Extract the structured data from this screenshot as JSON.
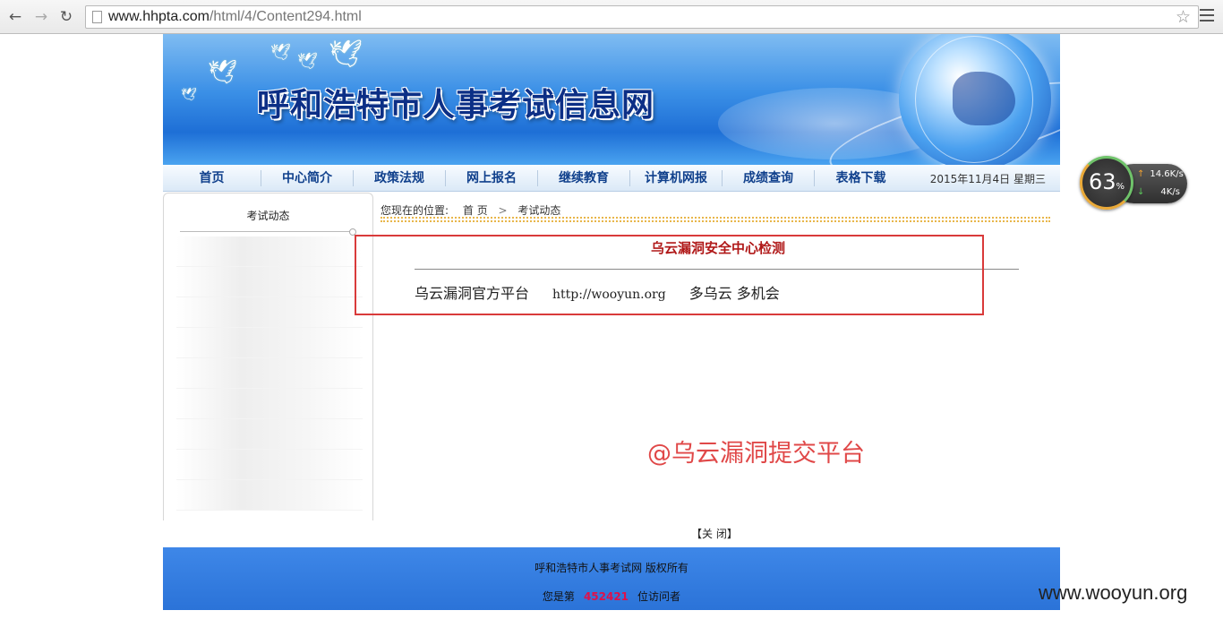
{
  "browser": {
    "url_host": "www.hhpta.com",
    "url_path": "/html/4/Content294.html"
  },
  "site": {
    "title": "呼和浩特市人事考试信息网",
    "nav": [
      "首页",
      "中心简介",
      "政策法规",
      "网上报名",
      "继续教育",
      "计算机网报",
      "成绩查询",
      "表格下载"
    ],
    "date": "2015年11月4日  星期三"
  },
  "sidebar": {
    "title": "考试动态"
  },
  "breadcrumb": {
    "prefix": "您现在的位置:",
    "home": "首 页",
    "separator": ">",
    "current": "考试动态"
  },
  "article": {
    "title": "乌云漏洞安全中心检测",
    "body_left": "乌云漏洞官方平台",
    "body_url": "http://wooyun.org",
    "body_right": "多乌云  多机会"
  },
  "watermark_cn": "@乌云漏洞提交平台",
  "close_link": "【关 闭】",
  "footer": {
    "copyright": "呼和浩特市人事考试网  版权所有",
    "visitor_prefix": "您是第",
    "visitor_count": "452421",
    "visitor_suffix": "位访问者"
  },
  "speed_widget": {
    "percent": "63",
    "percent_unit": "%",
    "upload": "14.6",
    "download": "4",
    "unit": "K/s"
  },
  "watermark_site": "www.wooyun.org"
}
